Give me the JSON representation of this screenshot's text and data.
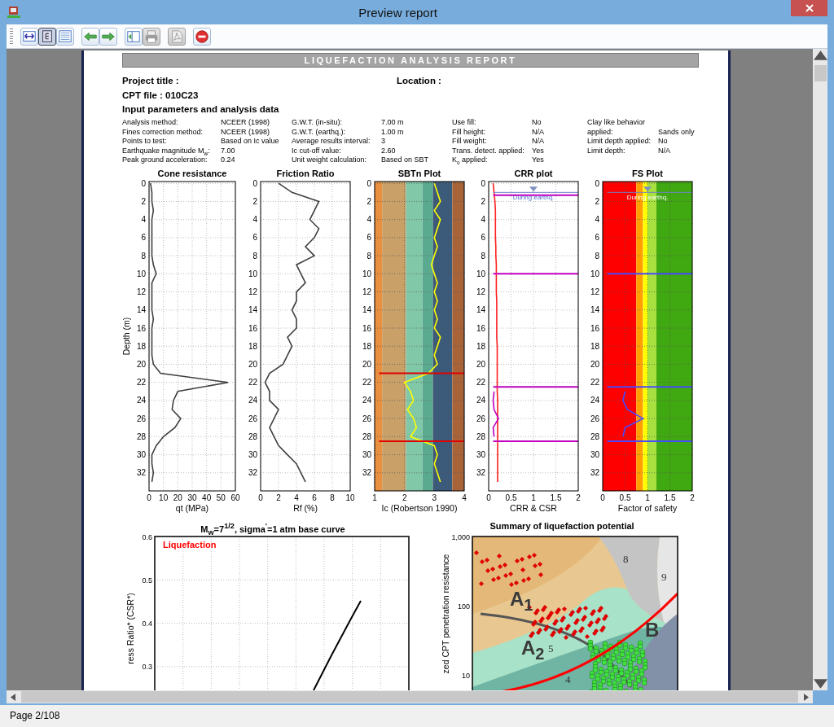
{
  "window": {
    "title": "Preview report"
  },
  "toolbar": {
    "groups": [
      [
        {
          "kind": "fit-width",
          "disabled": false,
          "selected": false
        },
        {
          "kind": "single-page",
          "disabled": false,
          "selected": true
        },
        {
          "kind": "page-width",
          "disabled": false,
          "selected": false
        }
      ],
      [
        {
          "kind": "back",
          "disabled": false
        },
        {
          "kind": "forward",
          "disabled": false
        }
      ],
      [
        {
          "kind": "export",
          "disabled": false
        },
        {
          "kind": "print",
          "disabled": true
        }
      ],
      [
        {
          "kind": "pdf",
          "disabled": true
        }
      ],
      [
        {
          "kind": "stop",
          "disabled": false
        }
      ]
    ]
  },
  "report": {
    "banner": "LIQUEFACTION ANALYSIS REPORT",
    "project_title_label": "Project title :",
    "location_label": "Location :",
    "cpt_file": "CPT file : 010C23",
    "section_heading": "Input parameters and analysis data",
    "parameter_groups": [
      [
        {
          "label": "Analysis method:",
          "value": "NCEER (1998)"
        },
        {
          "label": "Fines correction method:",
          "value": "NCEER (1998)"
        },
        {
          "label": "Points to test:",
          "value": "Based on Ic value"
        },
        {
          "label": "Earthquake magnitude M$_{w}$:",
          "value": "7.00"
        },
        {
          "label": "Peak ground acceleration:",
          "value": "0.24"
        }
      ],
      [
        {
          "label": "G.W.T. (in-situ):",
          "value": "7.00 m"
        },
        {
          "label": "G.W.T. (earthq.):",
          "value": "1.00 m"
        },
        {
          "label": "Average results interval:",
          "value": "3"
        },
        {
          "label": "Ic cut-off value:",
          "value": "2.60"
        },
        {
          "label": "Unit weight calculation:",
          "value": "Based on SBT"
        }
      ],
      [
        {
          "label": "Use fill:",
          "value": "No"
        },
        {
          "label": "Fill height:",
          "value": "N/A"
        },
        {
          "label": "Fill weight:",
          "value": "N/A"
        },
        {
          "label": "Trans. detect. applied:",
          "value": "Yes"
        },
        {
          "label": "K$_{o}$ applied:",
          "value": "Yes"
        }
      ],
      [
        {
          "label": "Clay like behavior applied:",
          "value": "Sands only"
        },
        {
          "label": "Limit depth applied:",
          "value": "No"
        },
        {
          "label": "Limit depth:",
          "value": "N/A"
        }
      ]
    ],
    "plots": [
      {
        "chart_data": {
          "type": "line",
          "orientation": "horizontal",
          "title": "Cone resistance",
          "xlabel": "qt (MPa)",
          "ylabel": "Depth (m)",
          "xlim": [
            0,
            60
          ],
          "ylim": [
            34,
            -0.2
          ],
          "xticks": [
            0,
            10,
            20,
            30,
            40,
            50,
            60
          ],
          "grid": true,
          "yticks": [
            0,
            2,
            4,
            6,
            8,
            10,
            12,
            14,
            16,
            18,
            20,
            22,
            24,
            26,
            28,
            30,
            32
          ],
          "x": [
            0,
            1,
            2,
            3,
            4,
            5,
            6,
            7,
            8,
            9,
            10,
            11,
            12,
            13,
            14,
            15,
            16,
            17,
            18,
            19,
            20,
            21,
            22,
            23,
            24,
            25,
            26,
            27,
            28,
            29,
            30,
            31,
            32,
            33
          ],
          "series": [
            {
              "color": "#404040",
              "values": [
                1,
                2,
                2,
                3,
                2,
                2,
                2,
                2,
                2,
                3,
                5,
                2,
                2,
                2,
                2,
                3,
                2,
                2,
                2,
                2,
                3,
                8,
                55,
                20,
                17,
                16,
                22,
                18,
                10,
                5,
                2,
                2,
                3,
                2
              ]
            }
          ]
        }
      },
      {
        "chart_data": {
          "type": "line",
          "orientation": "horizontal",
          "title": "Friction Ratio",
          "xlabel": "Rf (%)",
          "xlim": [
            0,
            10
          ],
          "ylim": [
            34,
            -0.2
          ],
          "xticks": [
            0,
            2,
            4,
            6,
            8,
            10
          ],
          "grid": true,
          "yticks": [
            0,
            2,
            4,
            6,
            8,
            10,
            12,
            14,
            16,
            18,
            20,
            22,
            24,
            26,
            28,
            30,
            32
          ],
          "x": [
            0,
            1,
            2,
            3,
            4,
            5,
            6,
            7,
            8,
            9,
            10,
            11,
            12,
            13,
            14,
            15,
            16,
            17,
            18,
            19,
            20,
            21,
            22,
            23,
            24,
            25,
            26,
            27,
            28,
            29,
            30,
            31,
            32,
            33
          ],
          "series": [
            {
              "color": "#404040",
              "values": [
                2,
                3.5,
                6.5,
                6,
                5.5,
                6.5,
                6,
                5,
                6,
                4,
                4.5,
                5,
                4,
                4,
                3.5,
                4,
                4,
                3,
                3.5,
                3,
                2.5,
                1,
                0.5,
                1,
                1,
                2,
                1.5,
                1,
                1.5,
                2,
                3,
                4,
                4.5,
                5
              ]
            }
          ]
        }
      },
      {
        "chart_data": {
          "type": "line",
          "orientation": "horizontal",
          "title": "SBTn Plot",
          "xlabel": "Ic (Robertson 1990)",
          "xlim": [
            1,
            4
          ],
          "ylim": [
            34,
            -0.2
          ],
          "xticks": [
            1,
            2,
            3,
            4
          ],
          "yticks": [
            0,
            2,
            4,
            6,
            8,
            10,
            12,
            14,
            16,
            18,
            20,
            22,
            24,
            26,
            28,
            30,
            32
          ],
          "x": [
            0,
            1,
            2,
            3,
            4,
            5,
            6,
            7,
            8,
            9,
            10,
            11,
            12,
            13,
            14,
            15,
            16,
            17,
            18,
            19,
            20,
            21,
            22,
            23,
            24,
            25,
            26,
            27,
            28,
            29,
            30,
            31,
            32,
            33
          ],
          "series": [
            {
              "color": "#ffff00",
              "values": [
                3,
                3.1,
                3.2,
                3,
                3.2,
                3.1,
                3,
                3.1,
                3,
                2.9,
                3,
                3.1,
                3,
                3.1,
                3,
                3.1,
                3,
                3.2,
                3.1,
                3,
                3.1,
                2.8,
                2,
                2.2,
                2.3,
                2.1,
                2.3,
                2.4,
                2.2,
                3,
                3.1,
                3,
                3.1,
                3.2
              ]
            }
          ],
          "grid": true,
          "bands": [
            {
              "axis": "x",
              "from": 1,
              "to": 1.25,
              "color": "#e89040"
            },
            {
              "axis": "x",
              "from": 1.25,
              "to": 2.05,
              "color": "#c8a068"
            },
            {
              "axis": "x",
              "from": 2.05,
              "to": 2.6,
              "color": "#80c8a8"
            },
            {
              "axis": "x",
              "from": 2.6,
              "to": 2.95,
              "color": "#5aaa90"
            },
            {
              "axis": "x",
              "from": 2.95,
              "to": 3.6,
              "color": "#3c5a7a"
            },
            {
              "axis": "x",
              "from": 3.6,
              "to": 4,
              "color": "#a86438"
            }
          ],
          "ref_lines": [
            {
              "axis": "y",
              "value": 21,
              "color": "#e00000"
            },
            {
              "axis": "y",
              "value": 28.5,
              "color": "#e00000"
            }
          ]
        }
      },
      {
        "chart_data": {
          "type": "line",
          "orientation": "horizontal",
          "title": "CRR plot",
          "xlabel": "CRR & CSR",
          "xlim": [
            0,
            2
          ],
          "ylim": [
            34,
            -0.2
          ],
          "xticks": [
            0,
            0.5,
            1,
            1.5,
            2
          ],
          "yticks": [
            0,
            2,
            4,
            6,
            8,
            10,
            12,
            14,
            16,
            18,
            20,
            22,
            24,
            26,
            28,
            30,
            32
          ],
          "x": [
            0,
            1,
            2,
            3,
            4,
            5,
            6,
            7,
            8,
            9,
            10,
            11,
            12,
            13,
            14,
            15,
            16,
            17,
            18,
            19,
            20,
            21,
            22,
            23,
            24,
            25,
            26,
            27,
            28,
            29,
            30,
            31,
            32,
            33
          ],
          "series": [
            {
              "color": "#ff2020",
              "values": [
                0.1,
                0.12,
                0.14,
                0.15,
                0.15,
                0.15,
                0.15,
                0.16,
                0.16,
                0.17,
                0.17,
                0.17,
                0.17,
                0.18,
                0.18,
                0.18,
                0.18,
                0.18,
                0.19,
                0.19,
                0.19,
                0.19,
                0.19,
                0.19,
                0.2,
                0.2,
                0.2,
                0.2,
                0.2,
                0.2,
                0.2,
                0.2,
                0.2,
                0.2
              ]
            },
            {
              "color": "#c000c0",
              "values": [
                null,
                null,
                null,
                null,
                null,
                null,
                null,
                null,
                null,
                null,
                null,
                null,
                null,
                null,
                null,
                null,
                null,
                null,
                null,
                null,
                null,
                null,
                null,
                0.12,
                0.1,
                0.12,
                0.22,
                0.1,
                0.12,
                null,
                null,
                null,
                null,
                null
              ]
            }
          ],
          "grid": true,
          "ref_lines": [
            {
              "axis": "y",
              "value": 1,
              "label": "During earthq.",
              "color": "#7080c8"
            },
            {
              "axis": "y",
              "value": 1.3,
              "color": "#c000c0"
            },
            {
              "axis": "y",
              "value": 10,
              "color": "#c000c0"
            },
            {
              "axis": "y",
              "value": 22.5,
              "color": "#c000c0"
            },
            {
              "axis": "y",
              "value": 28.5,
              "color": "#c000c0"
            }
          ]
        }
      },
      {
        "chart_data": {
          "type": "line",
          "orientation": "horizontal",
          "title": "FS Plot",
          "xlabel": "Factor of safety",
          "xlim": [
            0,
            2
          ],
          "ylim": [
            34,
            -0.2
          ],
          "xticks": [
            0,
            0.5,
            1,
            1.5,
            2
          ],
          "yticks": [
            0,
            2,
            4,
            6,
            8,
            10,
            12,
            14,
            16,
            18,
            20,
            22,
            24,
            26,
            28,
            30,
            32
          ],
          "x": [
            23,
            24,
            25,
            26,
            27,
            28
          ],
          "series": [
            {
              "color": "#4848ff",
              "values": [
                0.5,
                0.45,
                0.55,
                0.9,
                0.5,
                0.45
              ]
            }
          ],
          "grid": true,
          "bands": [
            {
              "axis": "x",
              "from": 0,
              "to": 0.75,
              "color": "#ff0000"
            },
            {
              "axis": "x",
              "from": 0.75,
              "to": 0.9,
              "color": "#ffa000"
            },
            {
              "axis": "x",
              "from": 0.9,
              "to": 1,
              "color": "#ffff00"
            },
            {
              "axis": "x",
              "from": 1,
              "to": 1.2,
              "color": "#a8e040"
            },
            {
              "axis": "x",
              "from": 1.2,
              "to": 2,
              "color": "#40a810"
            }
          ],
          "ref_lines": [
            {
              "axis": "y",
              "value": 1,
              "label": "During earthq.",
              "color": "#7080c8"
            },
            {
              "axis": "y",
              "value": 10,
              "color": "#4848ff"
            },
            {
              "axis": "y",
              "value": 22.5,
              "color": "#4848ff"
            },
            {
              "axis": "y",
              "value": 28.5,
              "color": "#4848ff"
            }
          ]
        }
      }
    ],
    "csr_chart": {
      "title": "M$_{w}$=7$^{1/2}$, sigma$^{'}$=1 atm base curve",
      "ylabel": "ress Ratio* (CSR*)",
      "y_tick_labels": [
        "0.6",
        "0.5",
        "0.4",
        "0.3"
      ],
      "zone_label": "Liquefaction"
    },
    "summary_chart": {
      "title": "Summary of liquefaction potential",
      "ylabel": "zed CPT penetration resistance",
      "y_tick_labels": [
        "1,000",
        "100",
        "10"
      ],
      "zone_labels": [
        "8",
        "9",
        "5",
        "4"
      ],
      "group_labels": [
        "A$_{1}$",
        "A$_{2}$",
        "B"
      ]
    }
  },
  "status_bar": {
    "text": "Page 2/108"
  }
}
